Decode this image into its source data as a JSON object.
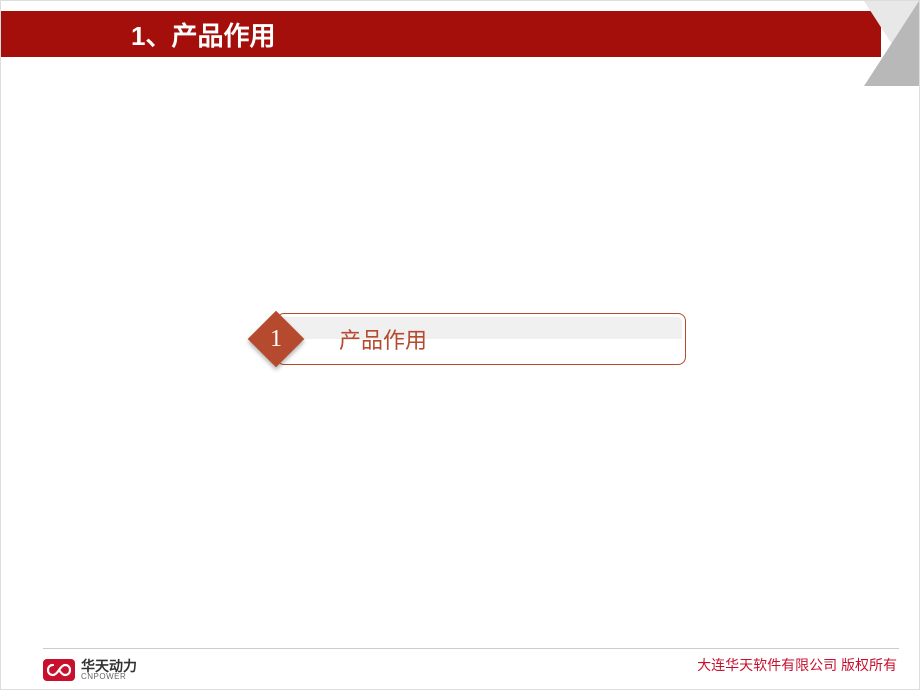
{
  "header": {
    "title": "1、产品作用"
  },
  "callout": {
    "number": "1",
    "text": "产品作用"
  },
  "footer": {
    "logo_cn": "华天动力",
    "logo_en": "CNPOWER",
    "copyright": "大连华天软件有限公司  版权所有"
  },
  "colors": {
    "brand_red": "#a40f0c",
    "accent_orange": "#b54a2e",
    "logo_red": "#c8102e"
  }
}
